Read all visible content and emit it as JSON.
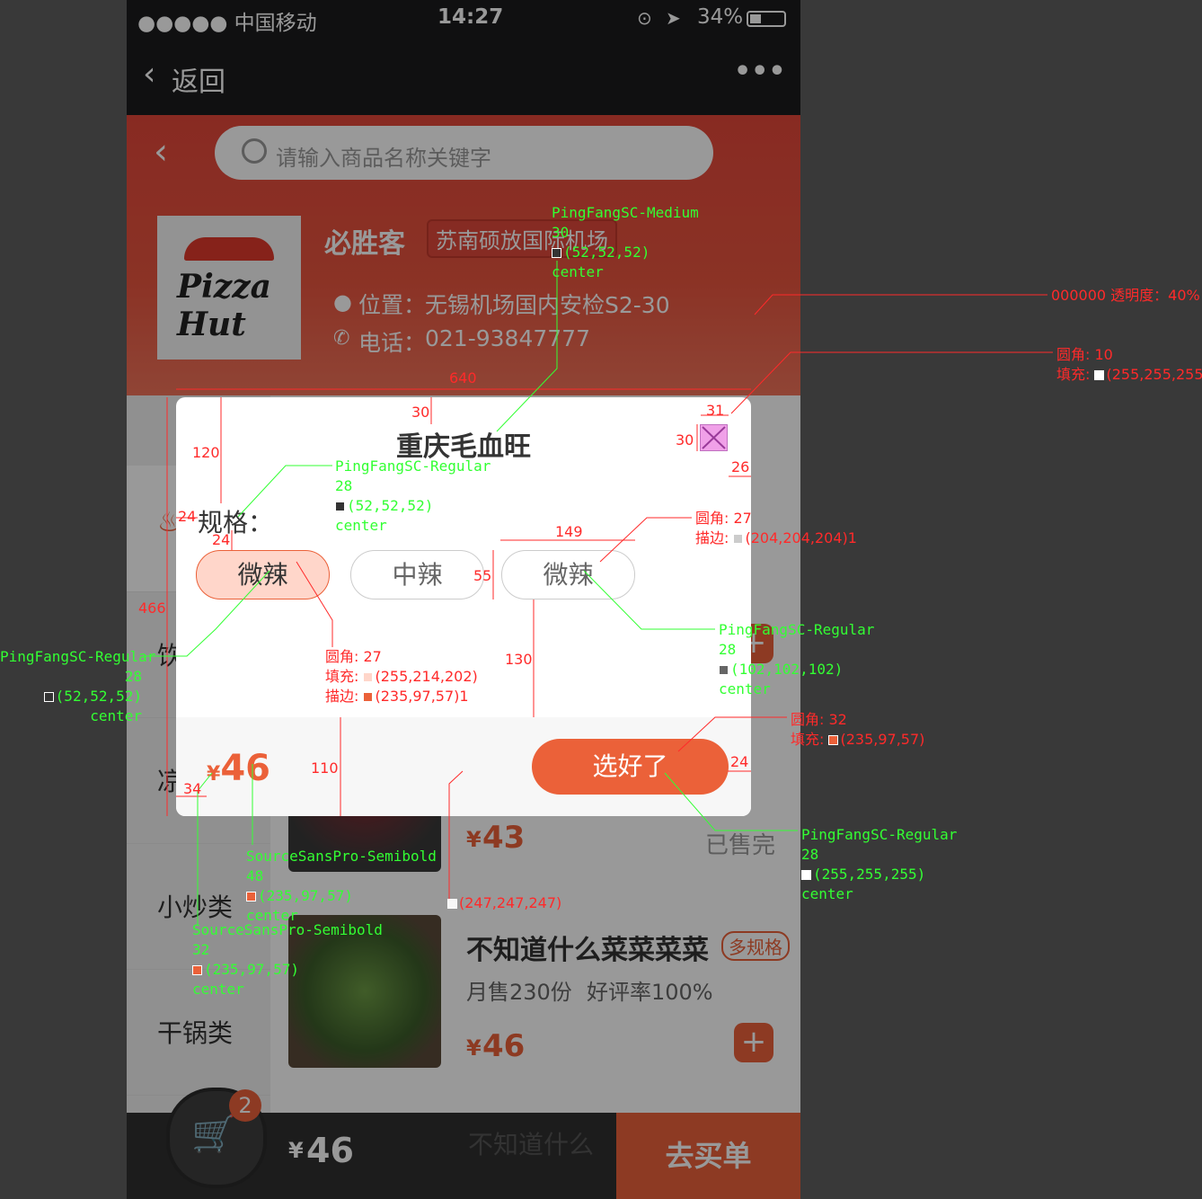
{
  "status": {
    "carrier": "●●●●● 中国移动",
    "time": "14:27",
    "battery": "34%"
  },
  "nav": {
    "back": "返回",
    "more": "•••"
  },
  "header": {
    "search_placeholder": "请输入商品名称关键字",
    "shop_name": "必胜客",
    "location_tag": "苏南硕放国际机场",
    "address_label": "位置：",
    "address": "无锡机场国内安检S2-30",
    "phone_label": "电话：",
    "phone": "021-93847777",
    "logo_text": "Pizza Hut"
  },
  "sidebar": {
    "items": [
      "饮",
      "凉",
      "小炒类",
      "干锅类"
    ]
  },
  "foods": [
    {
      "price_symbol": "¥",
      "price": "43",
      "sold_out": "已售完"
    },
    {
      "name": "不知道什么菜菜菜菜",
      "tag": "多规格",
      "monthly": "月售230份",
      "rating": "好评率100%",
      "price_symbol": "¥",
      "price": "46"
    }
  ],
  "cart": {
    "count": "2",
    "total_symbol": "¥",
    "total": "46",
    "hint": "不知道什么",
    "checkout": "去买单"
  },
  "modal": {
    "title": "重庆毛血旺",
    "spec_label": "规格：",
    "options": [
      "微辣",
      "中辣",
      "微辣"
    ],
    "price_symbol": "¥",
    "price": "46",
    "confirm": "选好了"
  },
  "annotations": {
    "title_font": {
      "font": "PingFangSC-Medium",
      "size": "30",
      "color": "(52,52,52)",
      "align": "center"
    },
    "mask": "000000 透明度：40%",
    "modal_box": {
      "radius": "圆角: 10",
      "fill": "填充: ",
      "fill_rgb": "(255,255,255)"
    },
    "option_border": {
      "radius": "圆角: 27",
      "stroke": "描边: ",
      "stroke_rgb": "(204,204,204)1"
    },
    "spec_font": {
      "font": "PingFangSC-Regular",
      "size": "28",
      "color": "(52,52,52)",
      "align": "center"
    },
    "option_font": {
      "font": "PingFangSC-Regular",
      "size": "28",
      "color": "(102,102,102)",
      "align": "center"
    },
    "sel_font": {
      "font": "PingFangSC-Regular",
      "size": "28",
      "color": "(52,52,52)",
      "align": "center"
    },
    "sel_box": {
      "radius": "圆角: 27",
      "fill": "填充: ",
      "fill_rgb": "(255,214,202)",
      "stroke": "描边: ",
      "stroke_rgb": "(235,97,57)1"
    },
    "confirm_box": {
      "radius": "圆角: 32",
      "fill": "填充: ",
      "fill_rgb": "(235,97,57)"
    },
    "confirm_font": {
      "font": "PingFangSC-Regular",
      "size": "28",
      "color": "(255,255,255)",
      "align": "center"
    },
    "price_font": {
      "font": "SourceSansPro-Semibold",
      "size": "48",
      "color": "(235,97,57)",
      "align": "center"
    },
    "yen_font": {
      "font": "SourceSansPro-Semibold",
      "size": "32",
      "color": "(235,97,57)",
      "align": "center"
    },
    "foot_fill": "(247,247,247)",
    "dims": {
      "w640": "640",
      "h466": "466",
      "t30": "30",
      "c31": "31",
      "c30": "30",
      "r26": "26",
      "y120": "120",
      "l24": "24",
      "l24b": "24",
      "w149": "149",
      "h55": "55",
      "h130": "130",
      "h110": "110",
      "l34": "34",
      "r24": "24"
    }
  },
  "colors": {
    "accent": "#eb6139",
    "sel_fill": "#ffd6ca",
    "foot": "#f7f7f7"
  }
}
